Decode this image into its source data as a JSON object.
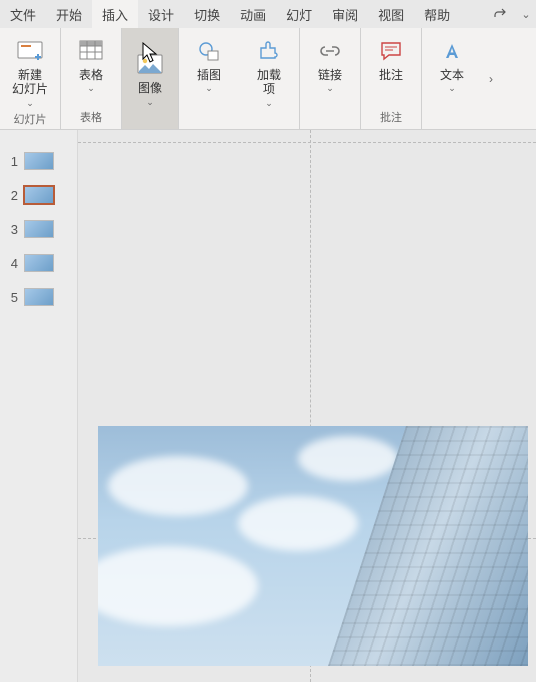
{
  "tabs": {
    "file": "文件",
    "home": "开始",
    "insert": "插入",
    "design": "设计",
    "transitions": "切换",
    "animations": "动画",
    "slideshow": "幻灯",
    "review": "审阅",
    "view": "视图",
    "help": "帮助"
  },
  "ribbon": {
    "new_slide": "新建\n幻灯片",
    "tables": "表格",
    "images": "图像",
    "illustrations": "插图",
    "addins": "加载\n项",
    "links": "链接",
    "comments": "批注",
    "text": "文本",
    "group_slide": "幻灯片",
    "group_tables": "表格",
    "group_comments": "批注"
  },
  "thumbs": {
    "items": [
      {
        "num": "1",
        "selected": false
      },
      {
        "num": "2",
        "selected": true
      },
      {
        "num": "3",
        "selected": false
      },
      {
        "num": "4",
        "selected": false
      },
      {
        "num": "5",
        "selected": false
      }
    ]
  }
}
